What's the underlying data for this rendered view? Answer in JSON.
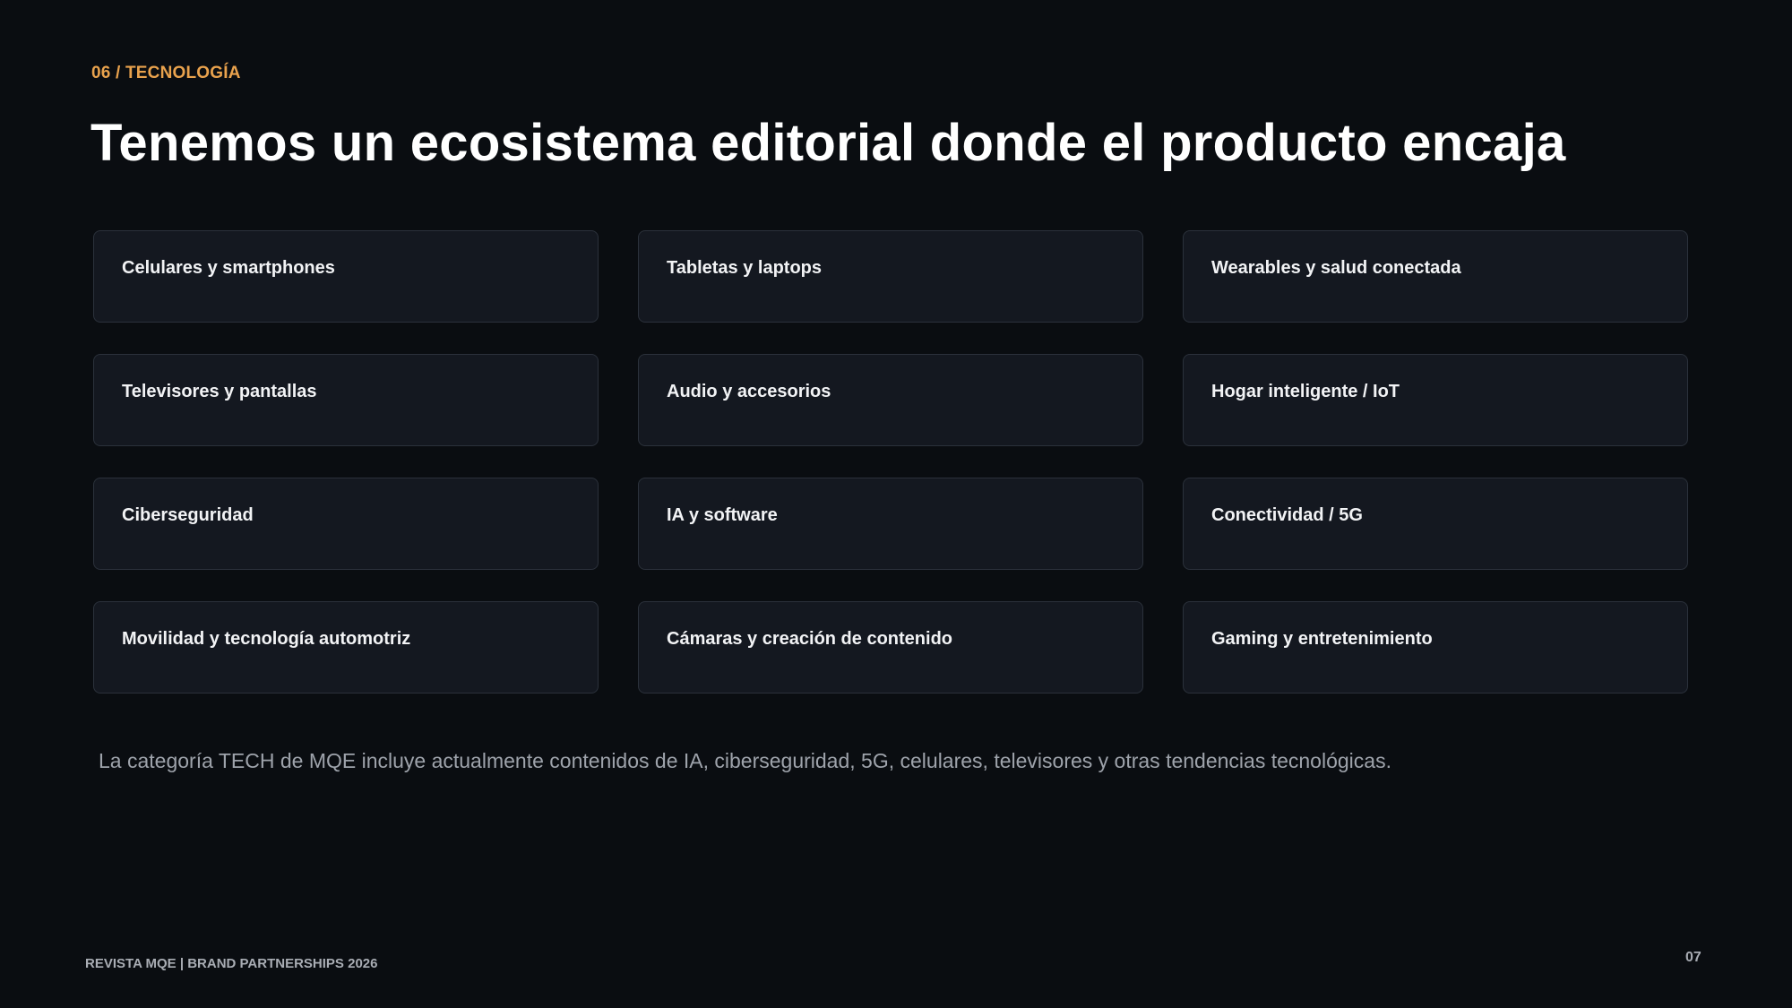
{
  "header": {
    "eyebrow": "06 / TECNOLOGÍA",
    "title": "Tenemos un ecosistema editorial donde el producto encaja"
  },
  "categories": [
    "Celulares y smartphones",
    "Tabletas y laptops",
    "Wearables y salud conectada",
    "Televisores y pantallas",
    "Audio y accesorios",
    "Hogar inteligente / IoT",
    "Ciberseguridad",
    "IA y software",
    "Conectividad / 5G",
    "Movilidad y tecnología automotriz",
    "Cámaras y creación de contenido",
    "Gaming y entretenimiento"
  ],
  "note": "La categoría TECH de MQE incluye actualmente contenidos de IA, ciberseguridad, 5G, celulares, televisores y otras tendencias tecnológicas.",
  "footer": {
    "brand": "REVISTA MQE  |  BRAND PARTNERSHIPS 2026",
    "page_number": "07"
  },
  "colors": {
    "background": "#0a0d11",
    "accent": "#e9a24d",
    "card_background": "#141820",
    "card_border": "#2b313b"
  }
}
